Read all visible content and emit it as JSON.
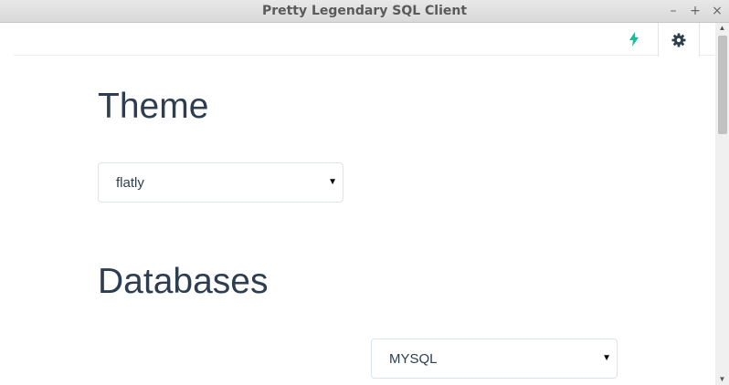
{
  "window": {
    "title": "Pretty Legendary SQL Client",
    "controls": {
      "minimize": "–",
      "maximize": "+",
      "close": "×"
    }
  },
  "toolbar": {
    "items": [
      {
        "icon": "bolt-icon",
        "color": "#18bc9c"
      },
      {
        "icon": "gear-icon",
        "color": "#2c3e50",
        "active": true
      }
    ]
  },
  "theme": {
    "heading": "Theme",
    "selected": "flatly"
  },
  "databases": {
    "heading": "Databases",
    "selected": "MYSQL"
  },
  "colors": {
    "text": "#2c3e50",
    "accent": "#18bc9c",
    "border": "#dce4ec"
  }
}
